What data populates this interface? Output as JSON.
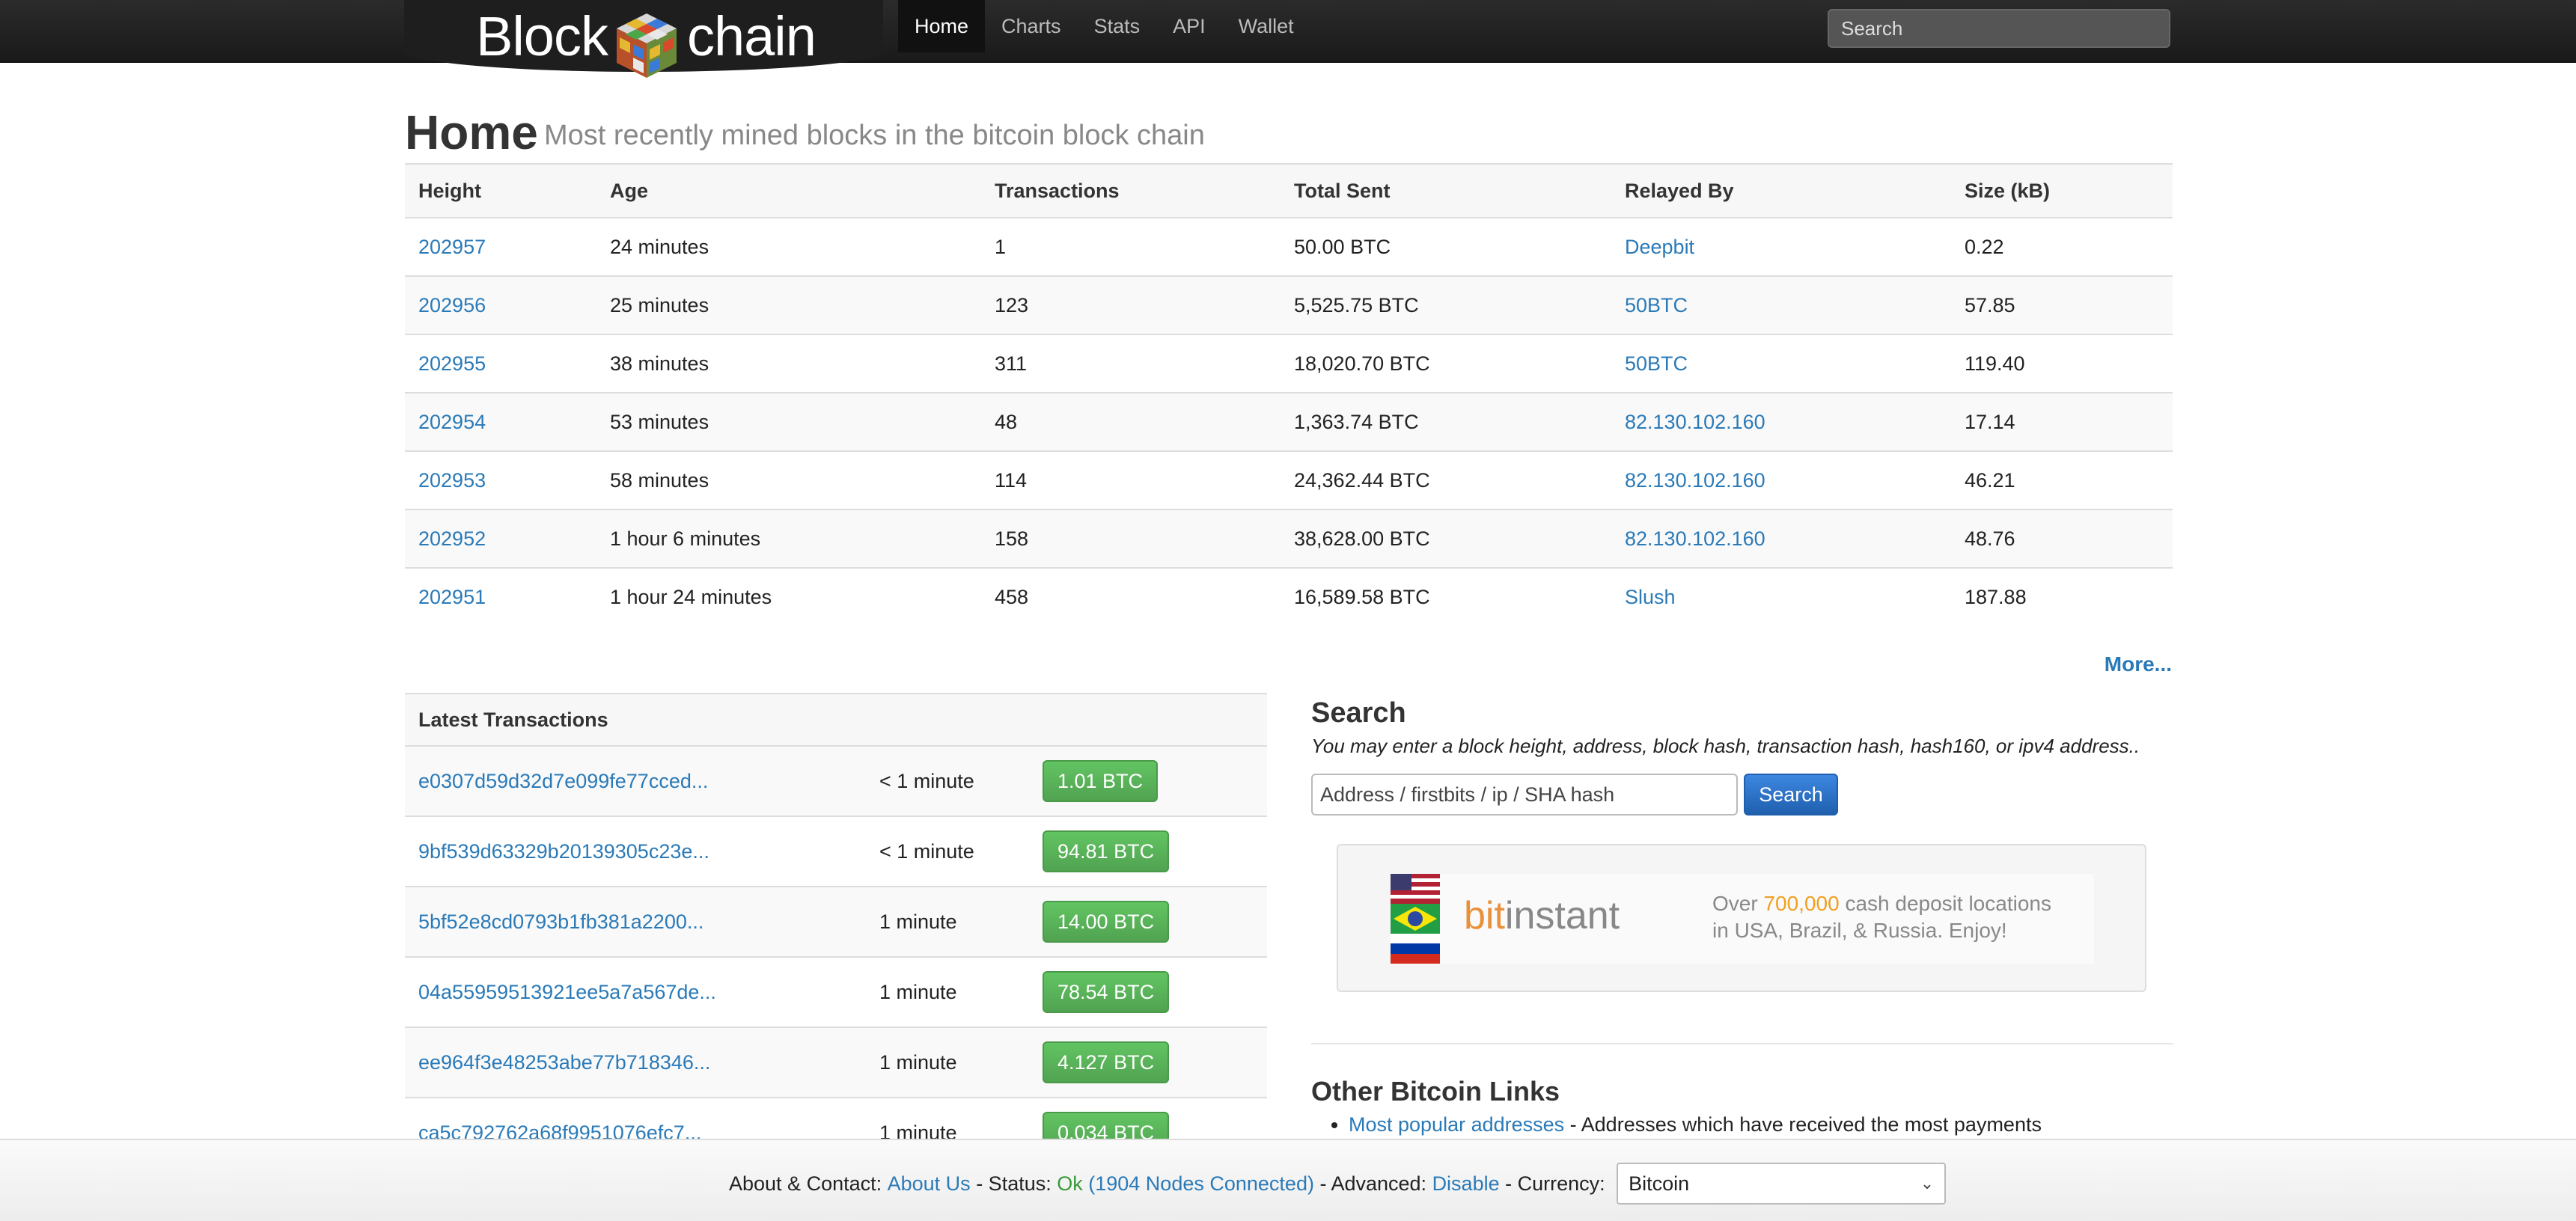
{
  "nav": {
    "logo_left": "Block",
    "logo_right": "chain",
    "items": [
      {
        "label": "Home",
        "active": true
      },
      {
        "label": "Charts",
        "active": false
      },
      {
        "label": "Stats",
        "active": false
      },
      {
        "label": "API",
        "active": false
      },
      {
        "label": "Wallet",
        "active": false
      }
    ],
    "search_placeholder": "Search"
  },
  "page": {
    "title": "Home",
    "subtitle": "Most recently mined blocks in the bitcoin block chain"
  },
  "blocks": {
    "headers": [
      "Height",
      "Age",
      "Transactions",
      "Total Sent",
      "Relayed By",
      "Size (kB)"
    ],
    "rows": [
      {
        "height": "202957",
        "age": "24 minutes",
        "tx": "1",
        "sent": "50.00 BTC",
        "relayed": "Deepbit",
        "size": "0.22"
      },
      {
        "height": "202956",
        "age": "25 minutes",
        "tx": "123",
        "sent": "5,525.75 BTC",
        "relayed": "50BTC",
        "size": "57.85"
      },
      {
        "height": "202955",
        "age": "38 minutes",
        "tx": "311",
        "sent": "18,020.70 BTC",
        "relayed": "50BTC",
        "size": "119.40"
      },
      {
        "height": "202954",
        "age": "53 minutes",
        "tx": "48",
        "sent": "1,363.74 BTC",
        "relayed": "82.130.102.160",
        "size": "17.14"
      },
      {
        "height": "202953",
        "age": "58 minutes",
        "tx": "114",
        "sent": "24,362.44 BTC",
        "relayed": "82.130.102.160",
        "size": "46.21"
      },
      {
        "height": "202952",
        "age": "1 hour 6 minutes",
        "tx": "158",
        "sent": "38,628.00 BTC",
        "relayed": "82.130.102.160",
        "size": "48.76"
      },
      {
        "height": "202951",
        "age": "1 hour 24 minutes",
        "tx": "458",
        "sent": "16,589.58 BTC",
        "relayed": "Slush",
        "size": "187.88"
      }
    ],
    "more_label": "More..."
  },
  "transactions": {
    "title": "Latest Transactions",
    "rows": [
      {
        "hash": "e0307d59d32d7e099fe77cced...",
        "age": "< 1 minute",
        "amount": "1.01 BTC"
      },
      {
        "hash": "9bf539d63329b20139305c23e...",
        "age": "< 1 minute",
        "amount": "94.81 BTC"
      },
      {
        "hash": "5bf52e8cd0793b1fb381a2200...",
        "age": "1 minute",
        "amount": "14.00 BTC"
      },
      {
        "hash": "04a55959513921ee5a7a567de...",
        "age": "1 minute",
        "amount": "78.54 BTC"
      },
      {
        "hash": "ee964f3e48253abe77b718346...",
        "age": "1 minute",
        "amount": "4.127 BTC"
      },
      {
        "hash": "ca5c792762a68f9951076efc7...",
        "age": "1 minute",
        "amount": "0.034 BTC"
      }
    ]
  },
  "search": {
    "title": "Search",
    "help": "You may enter a block height, address, block hash, transaction hash, hash160, or ipv4 address..",
    "placeholder": "Address / firstbits / ip / SHA hash",
    "button": "Search"
  },
  "ad": {
    "brand_prefix": "bit",
    "brand_suffix": "instant",
    "line1_a": "Over ",
    "line1_hi": "700,000",
    "line1_b": " cash deposit locations",
    "line2": "in USA, Brazil, & Russia. Enjoy!"
  },
  "links": {
    "title": "Other Bitcoin Links",
    "items": [
      {
        "label": "Most popular addresses",
        "desc": " - Addresses which have received the most payments"
      }
    ]
  },
  "footer": {
    "about_prefix": "About & Contact: ",
    "about_link": "About Us",
    "status_prefix": " - Status: ",
    "status_ok": "Ok",
    "nodes": " (1904 Nodes Connected)",
    "advanced_prefix": " - Advanced: ",
    "advanced_link": "Disable",
    "currency_prefix": " - Currency: ",
    "currency_value": "Bitcoin"
  },
  "colors": {
    "link": "#2a7ab8",
    "btc_green": "#5bb75b",
    "search_blue": "#2a6fcf"
  }
}
